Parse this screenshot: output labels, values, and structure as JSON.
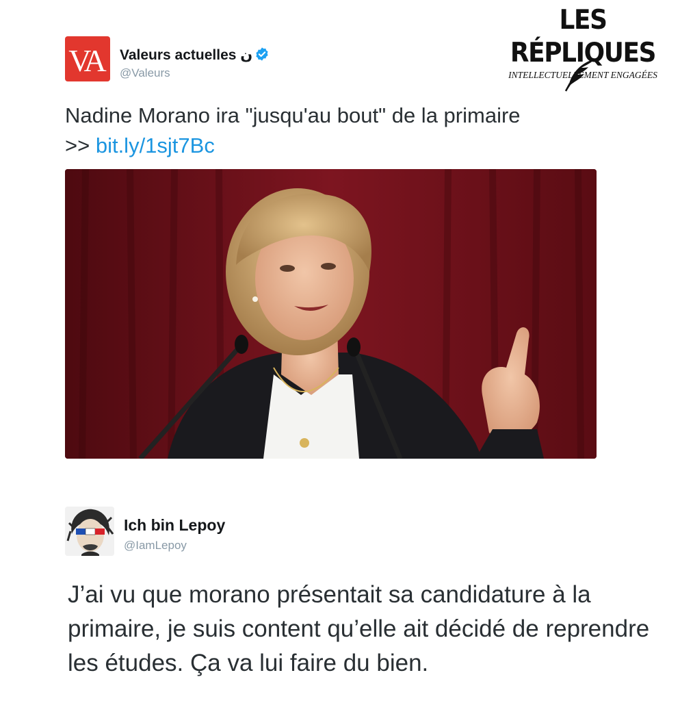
{
  "brand": {
    "title": "LES RÉPLIQUES",
    "subtitle": "INTELLECTUELLEMENT ENGAGÉES",
    "icon": "quill-icon"
  },
  "tweet1": {
    "avatar_text": "VA",
    "display_name": "Valeurs actuelles ن",
    "handle": "@Valeurs",
    "verified": true,
    "text": "Nadine Morano ira \"jusqu'au bout\" de la primaire",
    "link_prefix": ">> ",
    "link": "bit.ly/1sjt7Bc",
    "colors": {
      "logo": "#e2372e",
      "link": "#1b95e0"
    }
  },
  "tweet2": {
    "display_name": "Ich bin Lepoy",
    "handle": "@IamLepoy",
    "text": "J’ai vu que morano présentait sa candidature à la primaire, je suis content qu’elle ait décidé de reprendre les études. Ça va lui faire du bien."
  }
}
